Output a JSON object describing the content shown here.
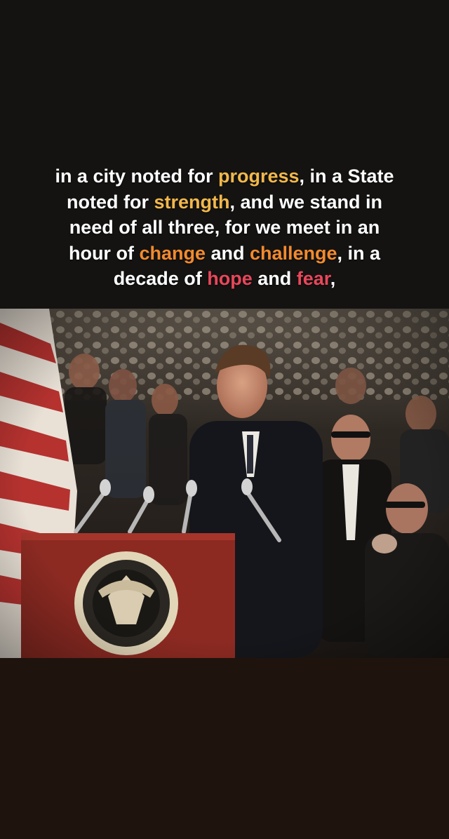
{
  "caption": {
    "line1": {
      "a": "in a city noted for ",
      "b": "progress",
      "c": ", in a State"
    },
    "line2": {
      "a": "noted for ",
      "b": "strength",
      "c": ", and we stand in"
    },
    "line3": {
      "a": "need of all three, for we meet in an"
    },
    "line4": {
      "a": "hour of ",
      "b": "change",
      "c": " and ",
      "d": "challenge",
      "e": ", in a"
    },
    "line5": {
      "a": "decade of ",
      "b": "hope",
      "c": " and ",
      "d": "fear",
      "e": ","
    }
  },
  "colors": {
    "yellow": "#f2b84b",
    "orange": "#f28a2e",
    "red": "#e8475a",
    "text": "#ffffff"
  }
}
